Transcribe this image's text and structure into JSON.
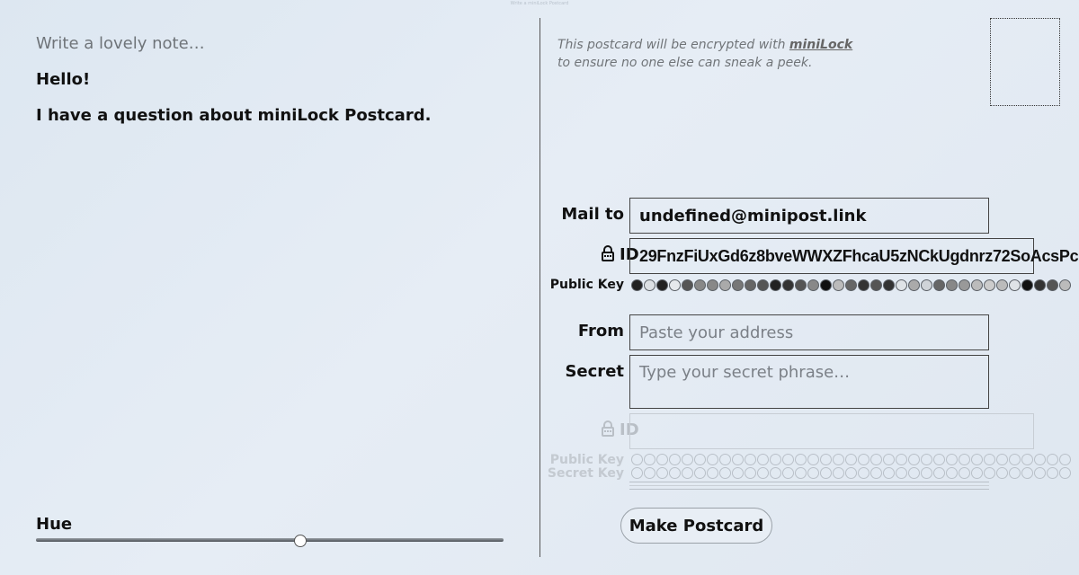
{
  "window": {
    "title": "Write a miniLock Postcard"
  },
  "note": {
    "placeholder": "Write a lovely note…",
    "lines": [
      "Hello!",
      "I have a question about miniLock Postcard."
    ]
  },
  "hue": {
    "label": "Hue",
    "value_fraction": 0.566
  },
  "encryption_note": {
    "line1_prefix": "This postcard will be encrypted with ",
    "link_label": "miniLock",
    "line2": "to ensure no one else can sneak a peek."
  },
  "recipient": {
    "mail_to_label": "Mail to",
    "mail_to_value": "undefined@minipost.link",
    "id_label": "ID",
    "id_value": "29FnzFiUxGd6z8bveWWXZFhcaU5zNCkUgdnrz72SoAcsPc",
    "public_key_label": "Public Key",
    "public_key_dots": [
      "#222",
      "#dce0e4",
      "#222",
      "#e6e9ec",
      "#555",
      "#888",
      "#888",
      "#aaa",
      "#777",
      "#666",
      "#555",
      "#222",
      "#333",
      "#555",
      "#888",
      "#111",
      "#bbb",
      "#666",
      "#333",
      "#555",
      "#333",
      "#dfe3e7",
      "#aaa",
      "#d0d4d8",
      "#666",
      "#888",
      "#999",
      "#bbb",
      "#ccc",
      "#bbb",
      "#dfe3e7",
      "#111",
      "#333",
      "#555",
      "#bbb"
    ]
  },
  "sender": {
    "from_label": "From",
    "from_placeholder": "Paste your address",
    "secret_label": "Secret",
    "secret_placeholder": "Type your secret phrase…",
    "id_label": "ID",
    "public_key_label": "Public Key",
    "secret_key_label": "Secret Key"
  },
  "actions": {
    "make_postcard": "Make Postcard"
  },
  "colors": {
    "background": "#e1e9f2",
    "text": "#111111",
    "placeholder": "#7b8087",
    "muted": "#b9bfc6"
  }
}
